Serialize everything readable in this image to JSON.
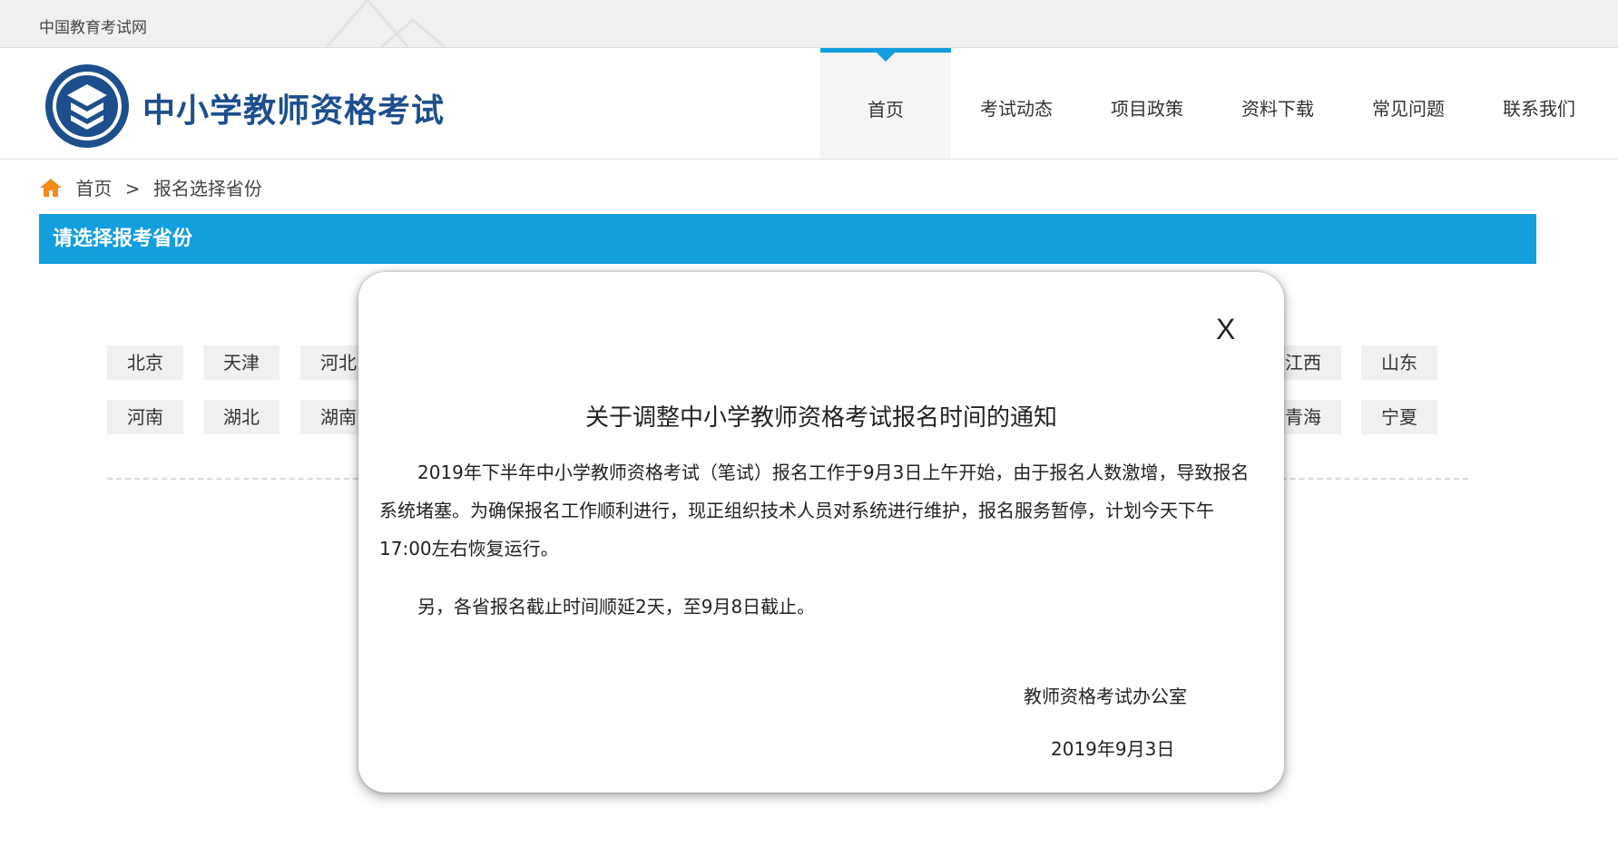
{
  "topbar": {
    "site_link": "中国教育考试网"
  },
  "header": {
    "title": "中小学教师资格考试",
    "nav": [
      {
        "label": "首页",
        "active": true
      },
      {
        "label": "考试动态"
      },
      {
        "label": "项目政策"
      },
      {
        "label": "资料下载"
      },
      {
        "label": "常见问题"
      },
      {
        "label": "联系我们"
      }
    ]
  },
  "breadcrumb": {
    "home": "首页",
    "sep": ">",
    "current": "报名选择省份"
  },
  "section": {
    "title": "请选择报考省份"
  },
  "provinces": {
    "row1": [
      "北京",
      "天津",
      "河北",
      "江西",
      "山东"
    ],
    "row2": [
      "河南",
      "湖北",
      "湖南",
      "青海",
      "宁夏"
    ]
  },
  "modal": {
    "close": "X",
    "title": "关于调整中小学教师资格考试报名时间的通知",
    "para1": "2019年下半年中小学教师资格考试（笔试）报名工作于9月3日上午开始，由于报名人数激增，导致报名系统堵塞。为确保报名工作顺利进行，现正组织技术人员对系统进行维护，报名服务暂停，计划今天下午17:00左右恢复运行。",
    "para2": "另，各省报名截止时间顺延2天，至9月8日截止。",
    "sign_org": "教师资格考试办公室",
    "sign_date": "2019年9月3日"
  },
  "colors": {
    "accent": "#139ede",
    "brand": "#1d4f8c"
  }
}
